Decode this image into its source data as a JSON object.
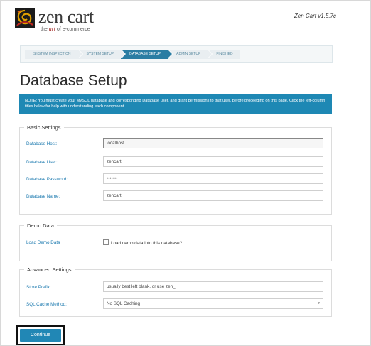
{
  "header": {
    "logo_word": "zen cart",
    "logo_tag_prefix": "the",
    "logo_tag_art": "art",
    "logo_tag_suffix": "of e-commerce",
    "version": "Zen Cart v1.5.7c"
  },
  "steps": [
    {
      "label": "System Inspection",
      "active": false
    },
    {
      "label": "System Setup",
      "active": false
    },
    {
      "label": "Database Setup",
      "active": true
    },
    {
      "label": "Admin Setup",
      "active": false
    },
    {
      "label": "Finished",
      "active": false
    }
  ],
  "page_title": "Database Setup",
  "notice": "NOTE: You must create your MySQL database and corresponding Database user, and grant permissions to that user, before proceeding on this page. Click the left-column titles below for help with understanding each component.",
  "basic": {
    "legend": "Basic Settings",
    "db_host": {
      "label": "Database Host:",
      "value": "localhost"
    },
    "db_user": {
      "label": "Database User:",
      "value": "zencart"
    },
    "db_password": {
      "label": "Database Password:",
      "value": "•••••••"
    },
    "db_name": {
      "label": "Database Name:",
      "value": "zencart"
    }
  },
  "demo": {
    "legend": "Demo Data",
    "label": "Load Demo Data",
    "checkbox_text": "Load demo data into this database?",
    "checked": false
  },
  "advanced": {
    "legend": "Advanced Settings",
    "store_prefix": {
      "label": "Store Prefix:",
      "placeholder": "usually best left blank, or use zen_"
    },
    "sql_cache": {
      "label": "SQL Cache Method:",
      "value": "No SQL Caching"
    }
  },
  "continue_label": "Continue",
  "colors": {
    "accent": "#1e88b4",
    "label_blue": "#1e7bb0",
    "logo_red": "#a0201c"
  }
}
